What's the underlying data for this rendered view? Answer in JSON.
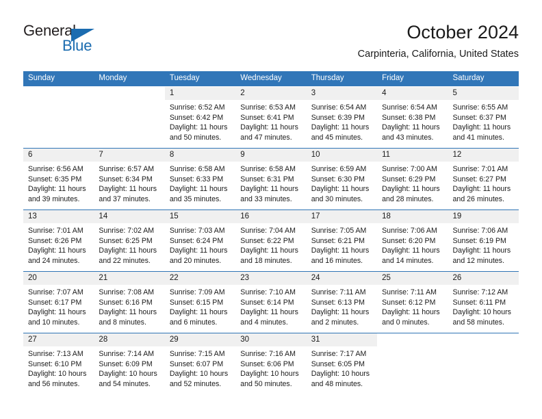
{
  "brand": {
    "name_part1": "General",
    "name_part2": "Blue",
    "logo_icon": "triangle-logo-icon"
  },
  "header": {
    "title": "October 2024",
    "subtitle": "Carpinteria, California, United States"
  },
  "theme": {
    "header_blue": "#3176b8",
    "rule_blue": "#2e74b5",
    "daynum_bg": "#f0f0f0",
    "brand_blue": "#1b6cb0",
    "text": "#1a1a1a"
  },
  "calendar": {
    "weekday_headers": [
      "Sunday",
      "Monday",
      "Tuesday",
      "Wednesday",
      "Thursday",
      "Friday",
      "Saturday"
    ],
    "labels": {
      "sunrise": "Sunrise:",
      "sunset": "Sunset:",
      "daylight": "Daylight:"
    },
    "weeks": [
      [
        {
          "day": "",
          "sunrise": "",
          "sunset": "",
          "daylight_line1": "",
          "daylight_line2": "",
          "blank": true
        },
        {
          "day": "",
          "sunrise": "",
          "sunset": "",
          "daylight_line1": "",
          "daylight_line2": "",
          "blank": true
        },
        {
          "day": "1",
          "sunrise": "Sunrise: 6:52 AM",
          "sunset": "Sunset: 6:42 PM",
          "daylight_line1": "Daylight: 11 hours",
          "daylight_line2": "and 50 minutes."
        },
        {
          "day": "2",
          "sunrise": "Sunrise: 6:53 AM",
          "sunset": "Sunset: 6:41 PM",
          "daylight_line1": "Daylight: 11 hours",
          "daylight_line2": "and 47 minutes."
        },
        {
          "day": "3",
          "sunrise": "Sunrise: 6:54 AM",
          "sunset": "Sunset: 6:39 PM",
          "daylight_line1": "Daylight: 11 hours",
          "daylight_line2": "and 45 minutes."
        },
        {
          "day": "4",
          "sunrise": "Sunrise: 6:54 AM",
          "sunset": "Sunset: 6:38 PM",
          "daylight_line1": "Daylight: 11 hours",
          "daylight_line2": "and 43 minutes."
        },
        {
          "day": "5",
          "sunrise": "Sunrise: 6:55 AM",
          "sunset": "Sunset: 6:37 PM",
          "daylight_line1": "Daylight: 11 hours",
          "daylight_line2": "and 41 minutes."
        }
      ],
      [
        {
          "day": "6",
          "sunrise": "Sunrise: 6:56 AM",
          "sunset": "Sunset: 6:35 PM",
          "daylight_line1": "Daylight: 11 hours",
          "daylight_line2": "and 39 minutes."
        },
        {
          "day": "7",
          "sunrise": "Sunrise: 6:57 AM",
          "sunset": "Sunset: 6:34 PM",
          "daylight_line1": "Daylight: 11 hours",
          "daylight_line2": "and 37 minutes."
        },
        {
          "day": "8",
          "sunrise": "Sunrise: 6:58 AM",
          "sunset": "Sunset: 6:33 PM",
          "daylight_line1": "Daylight: 11 hours",
          "daylight_line2": "and 35 minutes."
        },
        {
          "day": "9",
          "sunrise": "Sunrise: 6:58 AM",
          "sunset": "Sunset: 6:31 PM",
          "daylight_line1": "Daylight: 11 hours",
          "daylight_line2": "and 33 minutes."
        },
        {
          "day": "10",
          "sunrise": "Sunrise: 6:59 AM",
          "sunset": "Sunset: 6:30 PM",
          "daylight_line1": "Daylight: 11 hours",
          "daylight_line2": "and 30 minutes."
        },
        {
          "day": "11",
          "sunrise": "Sunrise: 7:00 AM",
          "sunset": "Sunset: 6:29 PM",
          "daylight_line1": "Daylight: 11 hours",
          "daylight_line2": "and 28 minutes."
        },
        {
          "day": "12",
          "sunrise": "Sunrise: 7:01 AM",
          "sunset": "Sunset: 6:27 PM",
          "daylight_line1": "Daylight: 11 hours",
          "daylight_line2": "and 26 minutes."
        }
      ],
      [
        {
          "day": "13",
          "sunrise": "Sunrise: 7:01 AM",
          "sunset": "Sunset: 6:26 PM",
          "daylight_line1": "Daylight: 11 hours",
          "daylight_line2": "and 24 minutes."
        },
        {
          "day": "14",
          "sunrise": "Sunrise: 7:02 AM",
          "sunset": "Sunset: 6:25 PM",
          "daylight_line1": "Daylight: 11 hours",
          "daylight_line2": "and 22 minutes."
        },
        {
          "day": "15",
          "sunrise": "Sunrise: 7:03 AM",
          "sunset": "Sunset: 6:24 PM",
          "daylight_line1": "Daylight: 11 hours",
          "daylight_line2": "and 20 minutes."
        },
        {
          "day": "16",
          "sunrise": "Sunrise: 7:04 AM",
          "sunset": "Sunset: 6:22 PM",
          "daylight_line1": "Daylight: 11 hours",
          "daylight_line2": "and 18 minutes."
        },
        {
          "day": "17",
          "sunrise": "Sunrise: 7:05 AM",
          "sunset": "Sunset: 6:21 PM",
          "daylight_line1": "Daylight: 11 hours",
          "daylight_line2": "and 16 minutes."
        },
        {
          "day": "18",
          "sunrise": "Sunrise: 7:06 AM",
          "sunset": "Sunset: 6:20 PM",
          "daylight_line1": "Daylight: 11 hours",
          "daylight_line2": "and 14 minutes."
        },
        {
          "day": "19",
          "sunrise": "Sunrise: 7:06 AM",
          "sunset": "Sunset: 6:19 PM",
          "daylight_line1": "Daylight: 11 hours",
          "daylight_line2": "and 12 minutes."
        }
      ],
      [
        {
          "day": "20",
          "sunrise": "Sunrise: 7:07 AM",
          "sunset": "Sunset: 6:17 PM",
          "daylight_line1": "Daylight: 11 hours",
          "daylight_line2": "and 10 minutes."
        },
        {
          "day": "21",
          "sunrise": "Sunrise: 7:08 AM",
          "sunset": "Sunset: 6:16 PM",
          "daylight_line1": "Daylight: 11 hours",
          "daylight_line2": "and 8 minutes."
        },
        {
          "day": "22",
          "sunrise": "Sunrise: 7:09 AM",
          "sunset": "Sunset: 6:15 PM",
          "daylight_line1": "Daylight: 11 hours",
          "daylight_line2": "and 6 minutes."
        },
        {
          "day": "23",
          "sunrise": "Sunrise: 7:10 AM",
          "sunset": "Sunset: 6:14 PM",
          "daylight_line1": "Daylight: 11 hours",
          "daylight_line2": "and 4 minutes."
        },
        {
          "day": "24",
          "sunrise": "Sunrise: 7:11 AM",
          "sunset": "Sunset: 6:13 PM",
          "daylight_line1": "Daylight: 11 hours",
          "daylight_line2": "and 2 minutes."
        },
        {
          "day": "25",
          "sunrise": "Sunrise: 7:11 AM",
          "sunset": "Sunset: 6:12 PM",
          "daylight_line1": "Daylight: 11 hours",
          "daylight_line2": "and 0 minutes."
        },
        {
          "day": "26",
          "sunrise": "Sunrise: 7:12 AM",
          "sunset": "Sunset: 6:11 PM",
          "daylight_line1": "Daylight: 10 hours",
          "daylight_line2": "and 58 minutes."
        }
      ],
      [
        {
          "day": "27",
          "sunrise": "Sunrise: 7:13 AM",
          "sunset": "Sunset: 6:10 PM",
          "daylight_line1": "Daylight: 10 hours",
          "daylight_line2": "and 56 minutes."
        },
        {
          "day": "28",
          "sunrise": "Sunrise: 7:14 AM",
          "sunset": "Sunset: 6:09 PM",
          "daylight_line1": "Daylight: 10 hours",
          "daylight_line2": "and 54 minutes."
        },
        {
          "day": "29",
          "sunrise": "Sunrise: 7:15 AM",
          "sunset": "Sunset: 6:07 PM",
          "daylight_line1": "Daylight: 10 hours",
          "daylight_line2": "and 52 minutes."
        },
        {
          "day": "30",
          "sunrise": "Sunrise: 7:16 AM",
          "sunset": "Sunset: 6:06 PM",
          "daylight_line1": "Daylight: 10 hours",
          "daylight_line2": "and 50 minutes."
        },
        {
          "day": "31",
          "sunrise": "Sunrise: 7:17 AM",
          "sunset": "Sunset: 6:05 PM",
          "daylight_line1": "Daylight: 10 hours",
          "daylight_line2": "and 48 minutes."
        },
        {
          "day": "",
          "sunrise": "",
          "sunset": "",
          "daylight_line1": "",
          "daylight_line2": "",
          "blank": true
        },
        {
          "day": "",
          "sunrise": "",
          "sunset": "",
          "daylight_line1": "",
          "daylight_line2": "",
          "blank": true
        }
      ]
    ]
  }
}
